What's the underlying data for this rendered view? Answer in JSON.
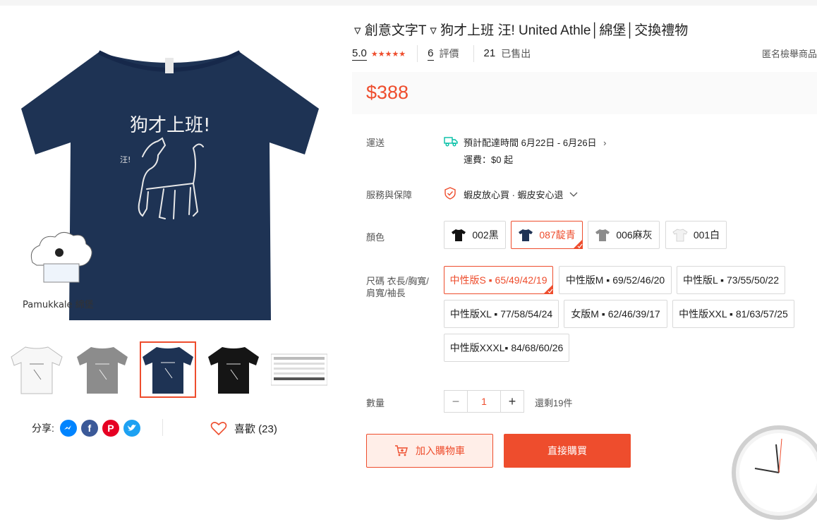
{
  "product": {
    "title": "▿ 創意文字T ▿ 狗才上班 汪! United Athle│綿堡│交換禮物",
    "rating": "5.0",
    "stars": "★★★★★",
    "reviews_count": "6",
    "reviews_label": "評價",
    "sold_count": "21",
    "sold_label": "已售出",
    "report_label": "匿名檢舉商品",
    "price": "$388",
    "shirt_text": "狗才上班!",
    "dog_bark": "汪!",
    "brand_mark": "Pamukkale 綿堡"
  },
  "shipping": {
    "label": "運送",
    "eta": "預計配達時間 6月22日 - 6月26日",
    "fee": "運費：$0 起"
  },
  "service": {
    "label": "服務與保障",
    "text": "蝦皮放心買 · 蝦皮安心退"
  },
  "color": {
    "label": "顏色",
    "options": [
      {
        "label": "002黑",
        "swatch": "#111111"
      },
      {
        "label": "087靛青",
        "swatch": "#1f3355",
        "selected": true
      },
      {
        "label": "006麻灰",
        "swatch": "#8c8c8c"
      },
      {
        "label": "001白",
        "swatch": "#f2f2f2"
      }
    ]
  },
  "size": {
    "label": "尺碼 衣長/胸寬/肩寬/袖長",
    "options": [
      {
        "label": "中性版S ▪ 65/49/42/19",
        "selected": true
      },
      {
        "label": "中性版M ▪ 69/52/46/20"
      },
      {
        "label": "中性版L ▪ 73/55/50/22"
      },
      {
        "label": "中性版XL ▪ 77/58/54/24"
      },
      {
        "label": "女版M ▪ 62/46/39/17"
      },
      {
        "label": "中性版XXL ▪ 81/63/57/25"
      },
      {
        "label": "中性版XXXL▪ 84/68/60/26"
      }
    ]
  },
  "quantity": {
    "label": "數量",
    "minus": "−",
    "value": "1",
    "plus": "+",
    "stock": "還剩19件"
  },
  "actions": {
    "add_to_cart": "加入購物車",
    "buy_now": "直接購買"
  },
  "social": {
    "share_label": "分享:",
    "like_label": "喜歡 (23)"
  },
  "colors": {
    "accent": "#ee4d2d",
    "navy_shirt": "#1e3354",
    "shipping_green": "#00bfa5"
  }
}
